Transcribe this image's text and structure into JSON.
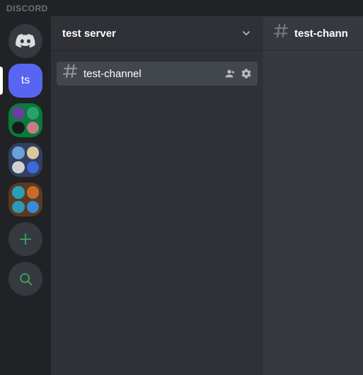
{
  "brand": "DISCORD",
  "colors": {
    "blurple": "#5865f2",
    "green": "#3ba55d",
    "bg_dark": "#202225",
    "bg_panel": "#2f3136",
    "bg_main": "#36393f"
  },
  "guilds": {
    "home_label": "Direct Messages",
    "selected": {
      "acronym": "ts",
      "name": "test server"
    },
    "folders": [
      {
        "id": "folder-1",
        "color": "green",
        "cells": [
          "#6a3fa0",
          "#2aa06a",
          "#1a1a1a",
          "#c77a8a"
        ]
      },
      {
        "id": "folder-2",
        "color": "blue",
        "cells": [
          "#6aa0d8",
          "#d8c89a",
          "#d0d0d0",
          "#3a6ad8"
        ]
      },
      {
        "id": "folder-3",
        "color": "brown",
        "cells": [
          "#2aa0b8",
          "#c86a2a",
          "#2a9ab8",
          "#3a8ad8"
        ]
      }
    ],
    "add_label": "Add a Server",
    "explore_label": "Explore Public Servers"
  },
  "server": {
    "name": "test server"
  },
  "channels": [
    {
      "icon": "hash",
      "name": "test-channel",
      "selected": true,
      "invite_label": "Create Invite",
      "settings_label": "Edit Channel"
    }
  ],
  "main": {
    "channel_name": "test-chann"
  }
}
